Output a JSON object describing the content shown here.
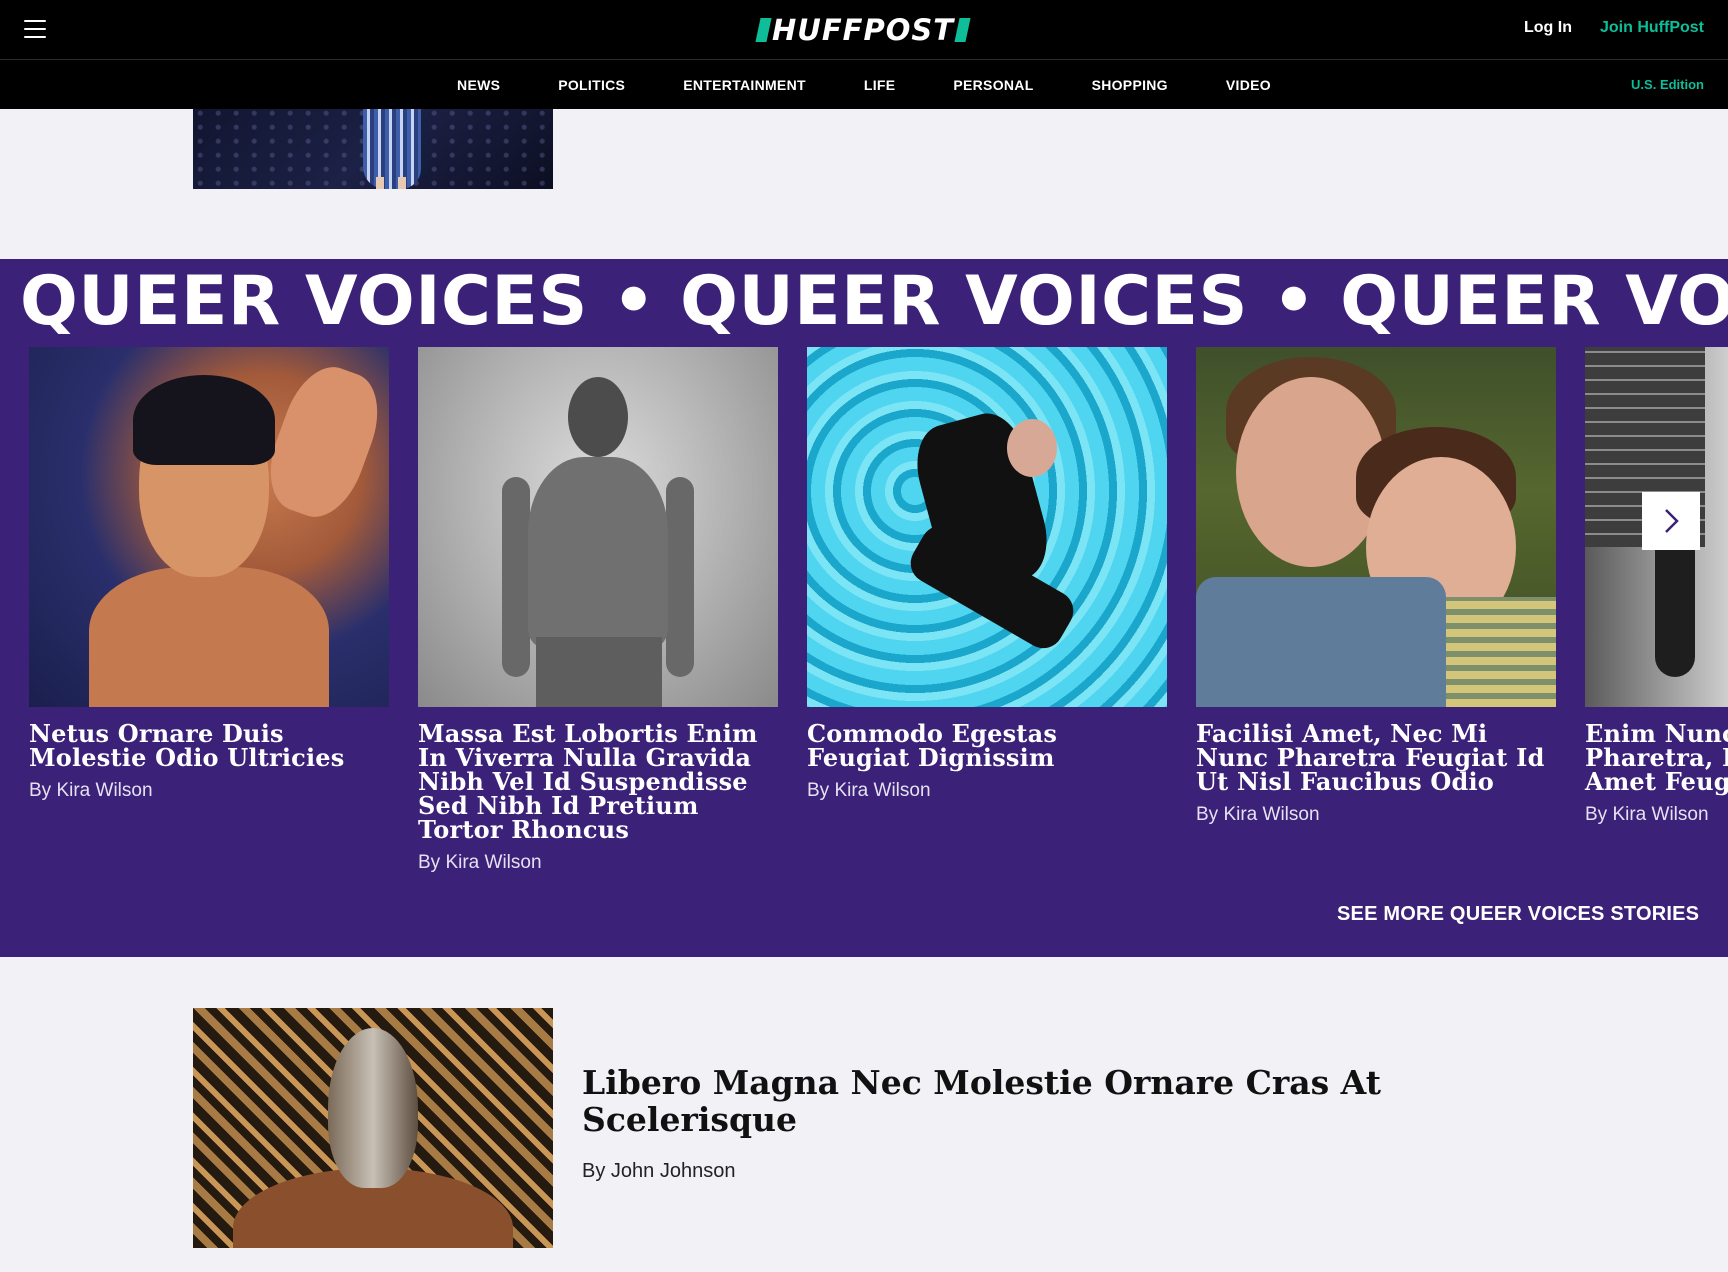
{
  "header": {
    "logo_text": "HUFFPOST",
    "login_label": "Log In",
    "join_label": "Join HuffPost",
    "nav": [
      "NEWS",
      "POLITICS",
      "ENTERTAINMENT",
      "LIFE",
      "PERSONAL",
      "SHOPPING",
      "VIDEO"
    ],
    "edition_label": "U.S. Edition"
  },
  "section": {
    "banner_text": "QUEER VOICES • QUEER VOICES • QUEER VOICES • QUEER VOICES",
    "cards": [
      {
        "title": "Netus Ornare Duis Molestie Odio Ultricies",
        "byline": "By Kira Wilson"
      },
      {
        "title": "Massa Est Lobortis Enim In Viverra Nulla Gravida Nibh Vel Id Suspendisse Sed Nibh Id Pretium Tortor Rhoncus",
        "byline": "By Kira Wilson"
      },
      {
        "title": "Commodo Egestas Feugiat Dignissim",
        "byline": "By Kira Wilson"
      },
      {
        "title": "Facilisi Amet, Nec Mi Nunc Pharetra Feugiat Id Ut Nisl Faucibus Odio",
        "byline": "By Kira Wilson"
      },
      {
        "title": "Enim Nunc Vulputate Pharetra, Duis Gravida Amet Feugiat Sed",
        "byline": "By Kira Wilson"
      }
    ],
    "see_more_label": "SEE MORE QUEER VOICES STORIES"
  },
  "article": {
    "headline": "Libero Magna Nec Molestie Ornare Cras At Scelerisque",
    "byline": "By John Johnson"
  },
  "colors": {
    "header_bg": "#000000",
    "accent": "#0dbe98",
    "section_bg": "#3b2178",
    "page_bg": "#f2f1f6"
  },
  "icons": {
    "menu": "hamburger-icon",
    "next": "chevron-right-icon"
  }
}
